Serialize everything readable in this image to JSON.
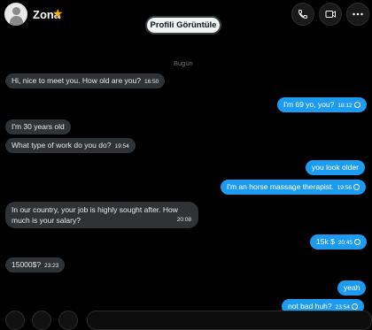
{
  "header": {
    "contact_name": "Zona",
    "star_glyph": "★",
    "profile_button": "Profili Görüntüle"
  },
  "date_separator": "Bugün",
  "messages": [
    {
      "dir": "in",
      "text": "Hi, nice to meet you. How old are you?",
      "time": "16:50"
    },
    {
      "dir": "out",
      "text": "I'm 69 yo, you?",
      "time": "18:12"
    },
    {
      "dir": "in",
      "text": "I'm 30 years old",
      "time": ""
    },
    {
      "dir": "in",
      "text": "What type of work do you do?",
      "time": "19:54"
    },
    {
      "dir": "out",
      "text": "you look older",
      "time": ""
    },
    {
      "dir": "out",
      "text": "I'm an horse massage therapist.",
      "time": "19:56"
    },
    {
      "dir": "in",
      "text": "In our country, your job is highly sought after. How much is your salary?",
      "time": "20:08"
    },
    {
      "dir": "out",
      "text": "15k $",
      "time": "20:45"
    },
    {
      "dir": "in",
      "text": "15000$?",
      "time": "23:23"
    },
    {
      "dir": "out",
      "text": "yeah",
      "time": ""
    },
    {
      "dir": "out",
      "text": "not bad huh?",
      "time": "23:54"
    }
  ],
  "colors": {
    "incoming_bubble": "#2f3336",
    "outgoing_bubble": "#1d9bf0",
    "background": "#000000",
    "star": "#f5b400"
  }
}
